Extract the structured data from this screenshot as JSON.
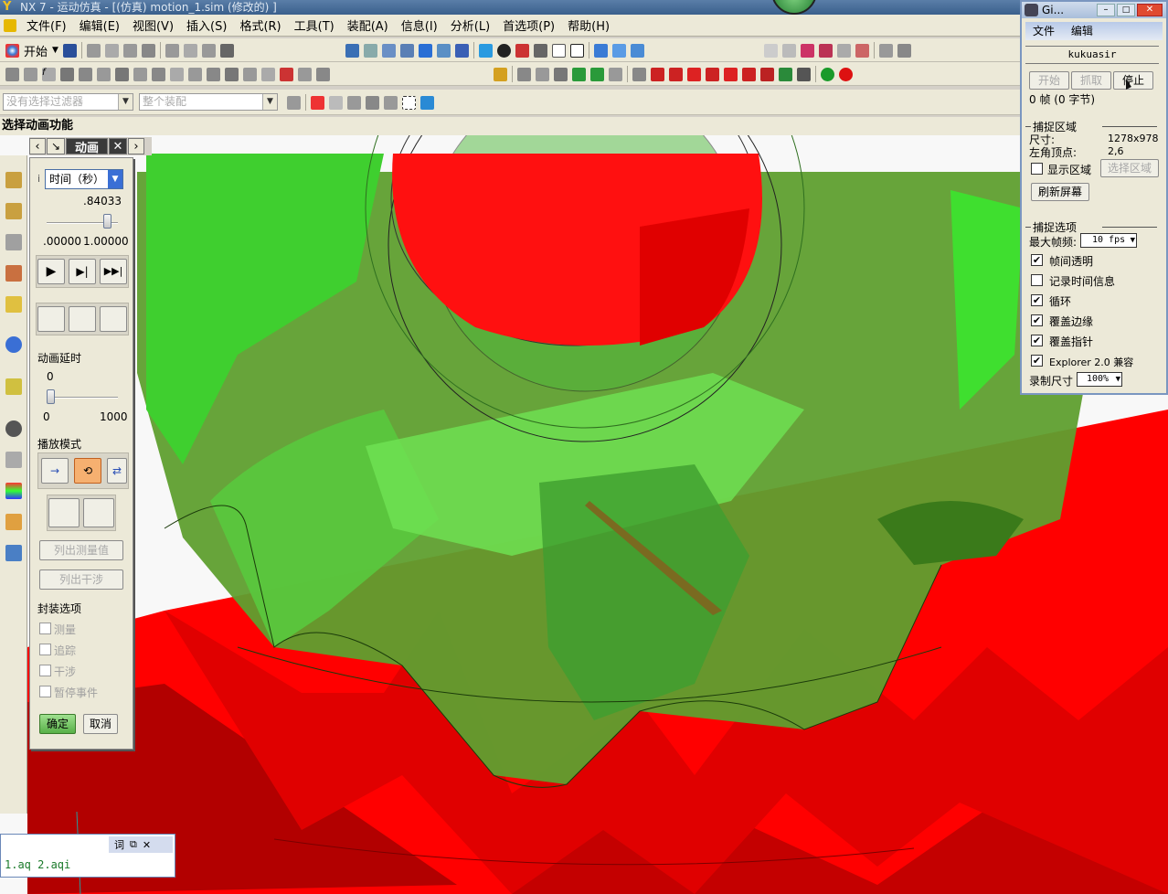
{
  "window": {
    "title": "NX 7 - 运动仿真 - [(仿真) motion_1.sim  (修改的) ]"
  },
  "menubar": {
    "items": [
      "文件(F)",
      "编辑(E)",
      "视图(V)",
      "插入(S)",
      "格式(R)",
      "工具(T)",
      "装配(A)",
      "信息(I)",
      "分析(L)",
      "首选项(P)",
      "帮助(H)"
    ]
  },
  "toolbar": {
    "start_label": "开始",
    "filter_placeholder": "没有选择过滤器",
    "scope_placeholder": "整个装配"
  },
  "command_prompt": "选择动画功能",
  "animation": {
    "tab_label": "动画",
    "time_unit": "时间（秒）",
    "time_value": ".84033",
    "time_fraction": 0.84,
    "time_min": ".00000",
    "time_max": "1.00000",
    "delay_label": "动画延时",
    "delay_value": "0",
    "delay_min": "0",
    "delay_max": "1000",
    "playmode_label": "播放模式",
    "list_measure_label": "列出测量值",
    "list_interference_label": "列出干涉",
    "envelope_label": "封装选项",
    "envelope_items": [
      "测量",
      "追踪",
      "干涉",
      "暂停事件"
    ],
    "ok_label": "确定",
    "cancel_label": "取消"
  },
  "gif_capture": {
    "title": "Gi...",
    "menu": [
      "文件",
      "编辑"
    ],
    "user_name": "kukuasir",
    "start_label": "开始",
    "grab_label": "抓取",
    "stop_label": "停止",
    "frames_info": "0 帧 (0 字节)",
    "region_header": "捕捉区域",
    "size_label": "尺寸:",
    "size_value": "1278x978",
    "corner_label": "左角顶点:",
    "corner_value": "2,6",
    "show_region_label": "显示区域",
    "select_region_label": "选择区域",
    "refresh_label": "刷新屏幕",
    "options_header": "捕捉选项",
    "max_fps_label": "最大帧频:",
    "max_fps_value": "10 fps",
    "options": [
      {
        "label": "帧间透明",
        "checked": true
      },
      {
        "label": "记录时间信息",
        "checked": false
      },
      {
        "label": "循环",
        "checked": true
      },
      {
        "label": "覆盖边缘",
        "checked": true
      },
      {
        "label": "覆盖指针",
        "checked": true
      },
      {
        "label": "Explorer 2.0 兼容",
        "checked": true
      }
    ],
    "record_size_label": "录制尺寸",
    "record_size_value": "100%"
  },
  "history": {
    "tab_label": "词",
    "text": "1.aq 2.aqi"
  },
  "colors": {
    "rack_red": "#ff0000",
    "rack_dark": "#b20000",
    "gear_green": "#3fbf2f",
    "gear_dark": "#5f8f2f"
  }
}
